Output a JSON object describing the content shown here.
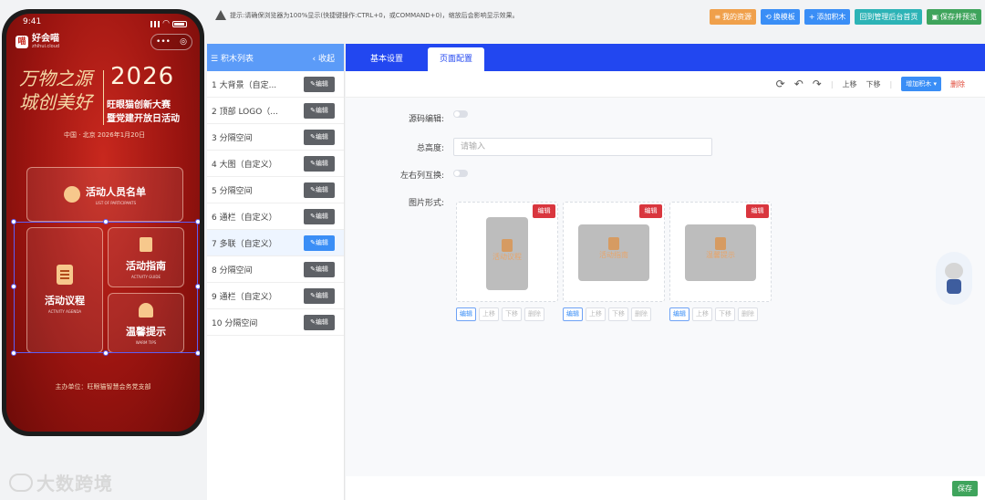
{
  "phone": {
    "status_time": "9:41",
    "brand_name": "好会喵",
    "brand_sub": "zhihui.cloud",
    "capsule_more": "•••",
    "capsule_close": "◎",
    "hero_calligraphy": "万物之源 城创美好",
    "hero_year": "2026",
    "hero_line1": "旺眼猫创新大赛",
    "hero_line2": "暨党建开放日活动",
    "hero_meta": "中国 · 北京 2026年1月20日",
    "cards": {
      "participants": {
        "title": "活动人员名单",
        "sub": "LIST OF PARTICIPANTS"
      },
      "agenda": {
        "title": "活动议程",
        "sub": "ACTIVITY AGENDA"
      },
      "guide": {
        "title": "活动指南",
        "sub": "ACTIVITY GUIDE"
      },
      "tips": {
        "title": "温馨提示",
        "sub": "WARM TIPS"
      }
    },
    "footer_org": "主办单位：旺眼猫智慧会务党支部"
  },
  "watermark": "大数跨境",
  "notice": "提示:请确保浏览器为100%显示(快捷键操作:CTRL+0，或COMMAND+0)，缩放后会影响显示效果。",
  "toolbar": [
    {
      "label": "我的资源",
      "icon": "list-icon",
      "color": "#f0a04b"
    },
    {
      "label": "换模板",
      "icon": "refresh-icon",
      "color": "#3a8ef6"
    },
    {
      "label": "添加积木",
      "icon": "plus-icon",
      "color": "#3a8ef6"
    },
    {
      "label": "回到管理后台首页",
      "icon": "",
      "color": "#2db3b6"
    },
    {
      "label": "保存并预览",
      "icon": "save-icon",
      "color": "#3fa45c"
    }
  ],
  "blocklist": {
    "title": "积木列表",
    "collapse": "‹ 收起",
    "edit_label": "编辑",
    "items": [
      "1 大背景（自定...",
      "2 顶部 LOGO（...",
      "3 分隔空间",
      "4 大图（自定义）",
      "5 分隔空间",
      "6 通栏（自定义）",
      "7 多联（自定义）",
      "8 分隔空间",
      "9 通栏（自定义）",
      "10 分隔空间"
    ],
    "active_index": 6
  },
  "tabs": [
    "基本设置",
    "页面配置"
  ],
  "active_tab": 1,
  "subtools": {
    "up": "上移",
    "down": "下移",
    "add": "增加积木",
    "delete": "删除"
  },
  "form": {
    "source_edit_label": "源码编辑:",
    "total_height_label": "总高度:",
    "total_height_placeholder": "请输入",
    "swap_label": "左右列互换:",
    "image_form_label": "图片形式:"
  },
  "image_cards": [
    {
      "edit_tag": "编辑",
      "caption": "活动议程"
    },
    {
      "edit_tag": "编辑",
      "caption": "活动指南"
    },
    {
      "edit_tag": "编辑",
      "caption": "温馨提示"
    }
  ],
  "card_actions": [
    "编辑",
    "上移",
    "下移",
    "删除"
  ],
  "save_label": "保存"
}
